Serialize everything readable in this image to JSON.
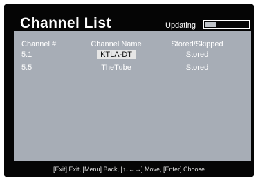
{
  "header": {
    "title": "Channel List",
    "status_label": "Updating",
    "progress": 0.25
  },
  "table": {
    "columns": [
      "Channel #",
      "Channel Name",
      "Stored/Skipped"
    ],
    "rows": [
      {
        "number": "5.1",
        "name": "KTLA-DT",
        "state": "Stored",
        "selected": true
      },
      {
        "number": "5.5",
        "name": "TheTube",
        "state": "Stored",
        "selected": false
      }
    ]
  },
  "footer": {
    "hint": "[Exit] Exit, [Menu] Back, [↑↓←→] Move, [Enter] Choose"
  },
  "colors": {
    "panel": "#a7adb6",
    "frame": "#050505",
    "text": "#ffffff",
    "selection": "#e6e6e6"
  }
}
